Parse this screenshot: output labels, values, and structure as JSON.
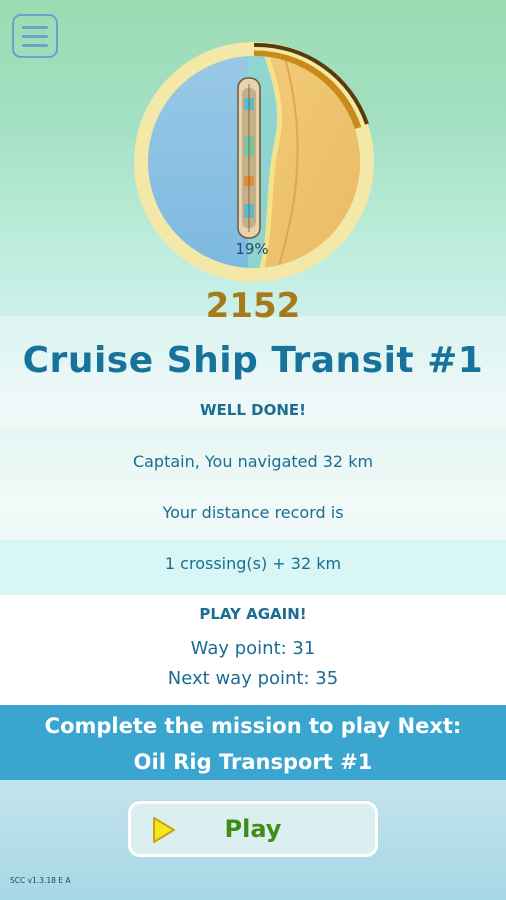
{
  "menu": {
    "icon": "hamburger-menu-icon"
  },
  "progress": {
    "percent_label": "19%",
    "ring_fill_fraction": 0.19
  },
  "score": "2152",
  "mission": {
    "title": "Cruise Ship Transit #1",
    "result": "WELL DONE!",
    "navigated": "Captain, You navigated 32 km",
    "record_label": "Your distance record is",
    "record_value": "1 crossing(s) + 32 km",
    "play_again": "PLAY AGAIN!",
    "way_point": "Way point: 31",
    "next_way_point": "Next way point: 35"
  },
  "next_mission": {
    "line1": "Complete the mission to play Next:",
    "line2": "Oil Rig Transport #1"
  },
  "play_button": {
    "label": "Play",
    "icon": "play-triangle-icon"
  },
  "version": "SCC v1.3.18 E A",
  "colors": {
    "title": "#17729c",
    "score": "#a67a18",
    "next_bar": "#3aa6cf",
    "play_text": "#3e8d18",
    "ring": "#f4e8a8"
  }
}
